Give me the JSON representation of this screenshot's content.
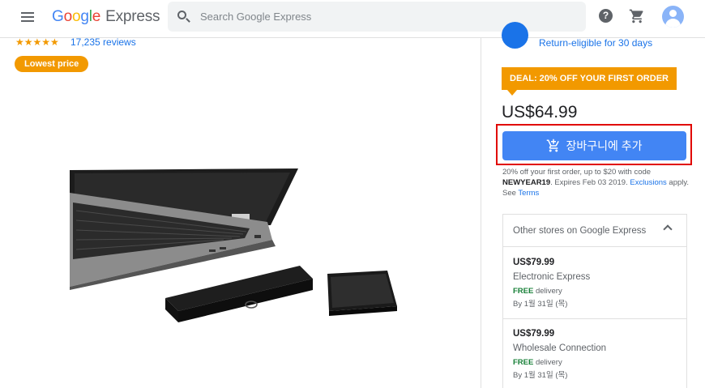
{
  "header": {
    "logo_letters": [
      "G",
      "o",
      "o",
      "g",
      "l",
      "e"
    ],
    "logo_suffix": "Express",
    "search_placeholder": "Search Google Express",
    "help_glyph": "?"
  },
  "product": {
    "stars": "★★★★★",
    "reviews": "17,235 reviews",
    "badge": "Lowest price"
  },
  "offer": {
    "return_text": "Return-eligible for 30 days",
    "deal": "DEAL: 20% OFF YOUR FIRST ORDER",
    "price": "US$64.99",
    "add_to_cart": "장바구니에 추가",
    "promo": {
      "line1": "20% off your first order, up to $20 with code",
      "code": "NEWYEAR19",
      "expires": ". Expires Feb 03 2019.",
      "exclusions": "Exclusions",
      "apply": "apply.",
      "see": "See",
      "terms": "Terms"
    }
  },
  "other_stores": {
    "title": "Other stores on Google Express",
    "stores": [
      {
        "price": "US$79.99",
        "name": "Electronic Express",
        "free": "FREE",
        "delivery": "delivery",
        "eta": "By 1월 31일 (목)"
      },
      {
        "price": "US$79.99",
        "name": "Wholesale Connection",
        "free": "FREE",
        "delivery": "delivery",
        "eta": "By 1월 31일 (목)"
      }
    ]
  },
  "colors": {
    "accent": "#4285f4",
    "badge_orange": "#f29900",
    "highlight_red": "#e10600",
    "link_blue": "#1a73e8",
    "free_green": "#188038"
  },
  "icons": [
    "menu-icon",
    "search-icon",
    "help-icon",
    "cart-icon",
    "avatar",
    "add-to-cart-icon",
    "chevron-up-icon"
  ]
}
